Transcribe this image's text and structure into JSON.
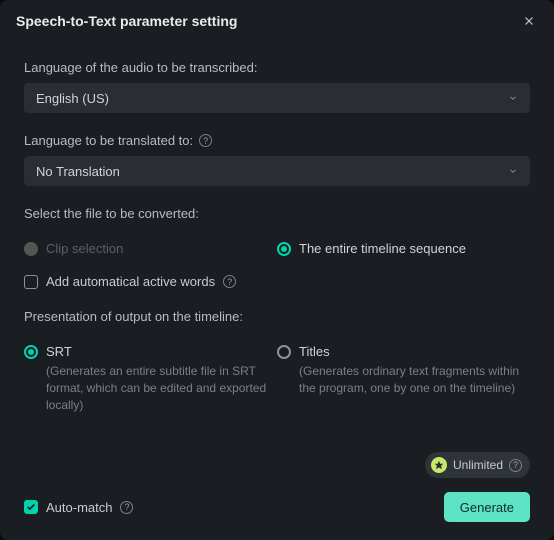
{
  "dialog": {
    "title": "Speech-to-Text parameter setting"
  },
  "transcribe": {
    "label": "Language of the audio to be transcribed:",
    "value": "English (US)"
  },
  "translate": {
    "label": "Language to be translated to:",
    "value": "No Translation"
  },
  "fileSelect": {
    "label": "Select the file to be converted:",
    "options": {
      "clip": "Clip selection",
      "timeline": "The entire timeline sequence"
    }
  },
  "autoWords": {
    "label": "Add automatical active words"
  },
  "presentation": {
    "label": "Presentation of output on the timeline:",
    "srt": {
      "label": "SRT",
      "desc": "(Generates an entire subtitle file in SRT format, which can be edited and exported locally)"
    },
    "titles": {
      "label": "Titles",
      "desc": "(Generates ordinary text fragments within the program, one by one on the timeline)"
    }
  },
  "unlimited": {
    "label": "Unlimited"
  },
  "autoMatch": {
    "label": "Auto-match"
  },
  "actions": {
    "generate": "Generate"
  }
}
